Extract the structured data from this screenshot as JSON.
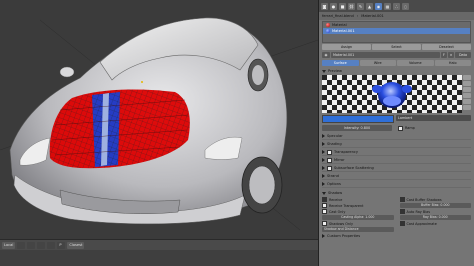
{
  "viewport": {
    "bottom_bar": {
      "mode": "Local",
      "buttons": [
        "",
        "",
        "",
        "",
        "P",
        "Closest"
      ]
    }
  },
  "properties": {
    "header_icons": [
      "camera-icon",
      "world-icon",
      "object-icon",
      "constraint-icon",
      "modifier-icon",
      "data-icon",
      "material-icon",
      "texture-icon",
      "particle-icon",
      "physics-icon"
    ],
    "breadcrumb": [
      "ferrari_final.blend",
      "Material.001"
    ],
    "material_slots": [
      {
        "name": "Material",
        "color": "#c00000",
        "selected": false
      },
      {
        "name": "Material.001",
        "color": "#1b3fcf",
        "selected": true
      }
    ],
    "slot_buttons": [
      "Assign",
      "Select",
      "Deselect"
    ],
    "material_name": "Material.001",
    "material_fake": "F",
    "data_label": "Data",
    "tabs": [
      "Surface",
      "Wire",
      "Volume",
      "Halo"
    ],
    "preview_title": "Preview",
    "diffuse": {
      "color": "#2f6fd8",
      "shader": "Lambert",
      "intensity_label": "Intensity: 0.800",
      "ramp_label": "Ramp"
    },
    "closed_panels": [
      "Specular",
      "Shading",
      "Transparency",
      "Mirror",
      "Subsurface Scattering",
      "Strand",
      "Options"
    ],
    "shadow": {
      "title": "Shadow",
      "left": [
        {
          "label": "Receive",
          "checked": true
        },
        {
          "label": "Receive Transparent",
          "checked": false
        },
        {
          "label": "Cast Only",
          "checked": false
        }
      ],
      "casting_alpha": "Casting Alpha: 1.000",
      "shadows_only": "Shadows Only",
      "shadow_and_distance": "Shadow and Distance",
      "right": [
        {
          "label": "Cast Buffer Shadows",
          "checked": true
        },
        {
          "label": "Buffer Bias: 0.000",
          "field": true
        },
        {
          "label": "Auto Ray Bias",
          "checked": true
        },
        {
          "label": "Ray Bias: 0.000",
          "field": true
        },
        {
          "label": "Cast Approximate",
          "checked": true
        }
      ]
    },
    "custom_properties": "Custom Properties"
  },
  "colors": {
    "accent": "#5680c2",
    "red_material": "#c00000",
    "blue_material": "#1b3fcf",
    "panel_bg": "#757575"
  }
}
